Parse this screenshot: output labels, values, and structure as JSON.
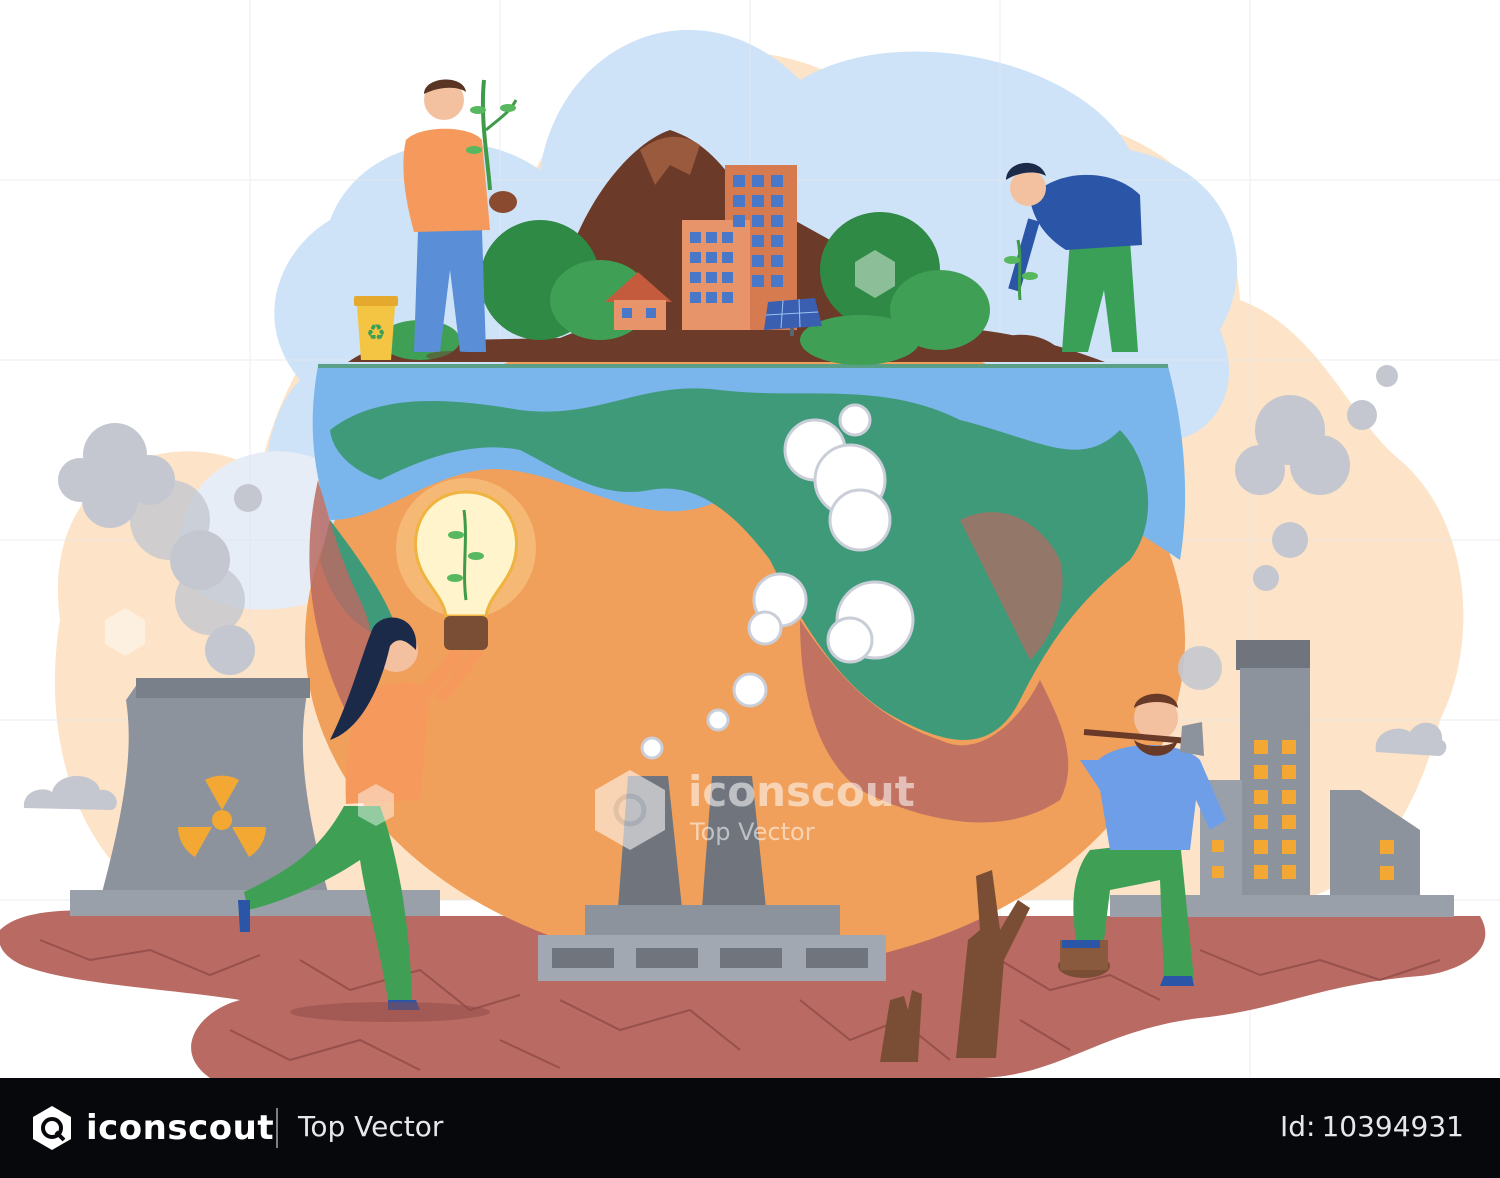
{
  "watermark": {
    "brand": "iconscout",
    "subtitle": "Top Vector"
  },
  "footer": {
    "brand": "iconscout",
    "tagline": "Top Vector",
    "id_label": "Id:",
    "id_value": "10394931"
  },
  "scene": {
    "icons": [
      "recycle-bin-icon",
      "radiation-icon",
      "solar-panel-icon",
      "light-bulb-icon"
    ],
    "colors": {
      "sky": "#cfe3f8",
      "ocean": "#7ab6ec",
      "land_green": "#3f9a7a",
      "dry_orange": "#f0a05a",
      "cracked_earth": "#b86a63",
      "smoke": "#c4c7cf",
      "factory": "#8d939c",
      "footer_bg": "#07080c"
    }
  }
}
